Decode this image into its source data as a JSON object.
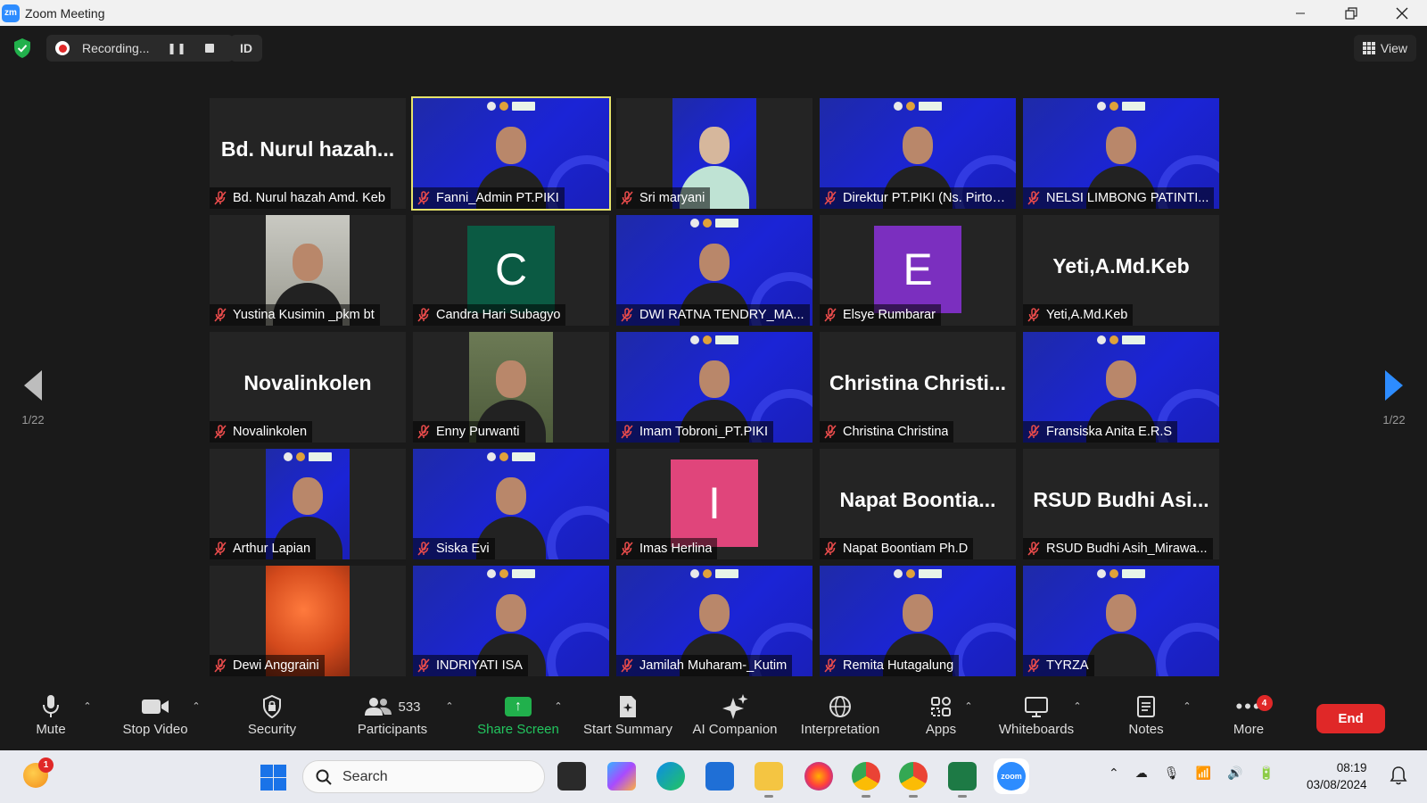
{
  "window": {
    "title": "Zoom Meeting",
    "app_icon": "zm"
  },
  "topbar": {
    "recording_label": "Recording...",
    "id_label": "ID",
    "view_label": "View"
  },
  "pager": {
    "left": "1/22",
    "right": "1/22"
  },
  "tiles": [
    {
      "name": "Bd. Nurul hazah Amd. Keb",
      "big": "Bd. Nurul hazah...",
      "kind": "name"
    },
    {
      "name": "Fanni_Admin PT.PIKI",
      "kind": "video",
      "active": true
    },
    {
      "name": "Sri maryani",
      "kind": "video-narrow"
    },
    {
      "name": "Direktur PT.PIKI (Ns. Pirton L...",
      "kind": "video"
    },
    {
      "name": "NELSI LIMBONG PATINTI...",
      "kind": "video"
    },
    {
      "name": "Yustina Kusimin _pkm bt",
      "kind": "video-narrow"
    },
    {
      "name": "Candra Hari Subagyo",
      "kind": "avatar",
      "letter": "C",
      "color": "#0b5a43"
    },
    {
      "name": "DWI RATNA TENDRY_MA...",
      "kind": "video"
    },
    {
      "name": "Elsye Rumbarar",
      "kind": "avatar",
      "letter": "E",
      "color": "#7b2fbf"
    },
    {
      "name": "Yeti,A.Md.Keb",
      "big": "Yeti,A.Md.Keb",
      "kind": "name"
    },
    {
      "name": "Novalinkolen",
      "big": "Novalinkolen",
      "kind": "name"
    },
    {
      "name": "Enny Purwanti",
      "kind": "video-narrow"
    },
    {
      "name": "Imam Tobroni_PT.PIKI",
      "kind": "video"
    },
    {
      "name": "Christina Christina",
      "big": "Christina Christi...",
      "kind": "name"
    },
    {
      "name": "Fransiska Anita E.R.S",
      "kind": "video"
    },
    {
      "name": "Arthur Lapian",
      "kind": "video-narrow"
    },
    {
      "name": "Siska Evi",
      "kind": "video"
    },
    {
      "name": "Imas Herlina",
      "kind": "avatar",
      "letter": "I",
      "color": "#e0457b"
    },
    {
      "name": "Napat Boontiam Ph.D",
      "big": "Napat Boontia...",
      "kind": "name"
    },
    {
      "name": "RSUD Budhi Asih_Mirawa...",
      "big": "RSUD Budhi Asi...",
      "kind": "name"
    },
    {
      "name": "Dewi Anggraini",
      "kind": "video-narrow"
    },
    {
      "name": "INDRIYATI ISA",
      "kind": "video"
    },
    {
      "name": "Jamilah Muharam-_Kutim",
      "kind": "video"
    },
    {
      "name": "Remita Hutagalung",
      "kind": "video"
    },
    {
      "name": "TYRZA",
      "kind": "video"
    }
  ],
  "toolbar": {
    "mute": "Mute",
    "stop_video": "Stop Video",
    "security": "Security",
    "participants": "Participants",
    "participants_count": "533",
    "share_screen": "Share Screen",
    "start_summary": "Start Summary",
    "ai_companion": "AI Companion",
    "interpretation": "Interpretation",
    "apps": "Apps",
    "whiteboards": "Whiteboards",
    "notes": "Notes",
    "more": "More",
    "more_badge": "4",
    "end": "End"
  },
  "taskbar": {
    "weather_badge": "1",
    "search_placeholder": "Search",
    "time": "08:19",
    "date": "03/08/2024"
  }
}
